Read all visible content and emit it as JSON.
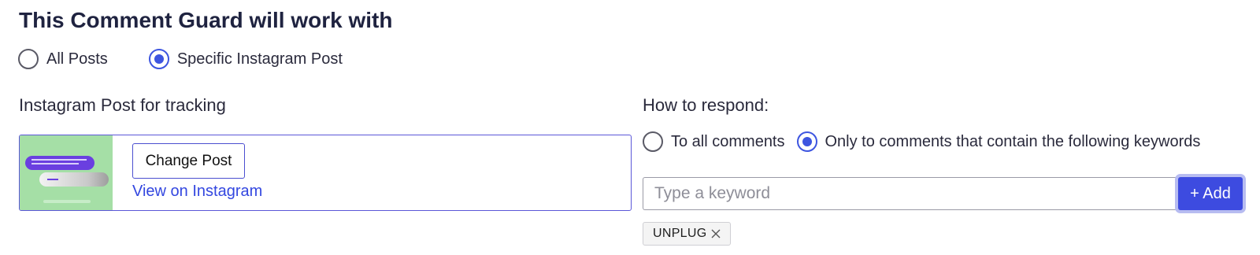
{
  "scope": {
    "title": "This Comment Guard will work with",
    "options": [
      {
        "label": "All Posts",
        "checked": false
      },
      {
        "label": "Specific Instagram Post",
        "checked": true
      }
    ]
  },
  "tracking": {
    "title": "Instagram Post for tracking",
    "change_button": "Change Post",
    "view_link": "View on Instagram"
  },
  "respond": {
    "title": "How to respond:",
    "options": [
      {
        "label": "To all comments",
        "checked": false
      },
      {
        "label": "Only to comments that contain the following keywords",
        "checked": true
      }
    ]
  },
  "keyword": {
    "placeholder": "Type a keyword",
    "value": "",
    "add_button": "+ Add",
    "tags": [
      {
        "label": "UNPLUG"
      }
    ]
  },
  "colors": {
    "accent": "#3d4be0",
    "thumbnail_bg": "#a5dfa6"
  }
}
